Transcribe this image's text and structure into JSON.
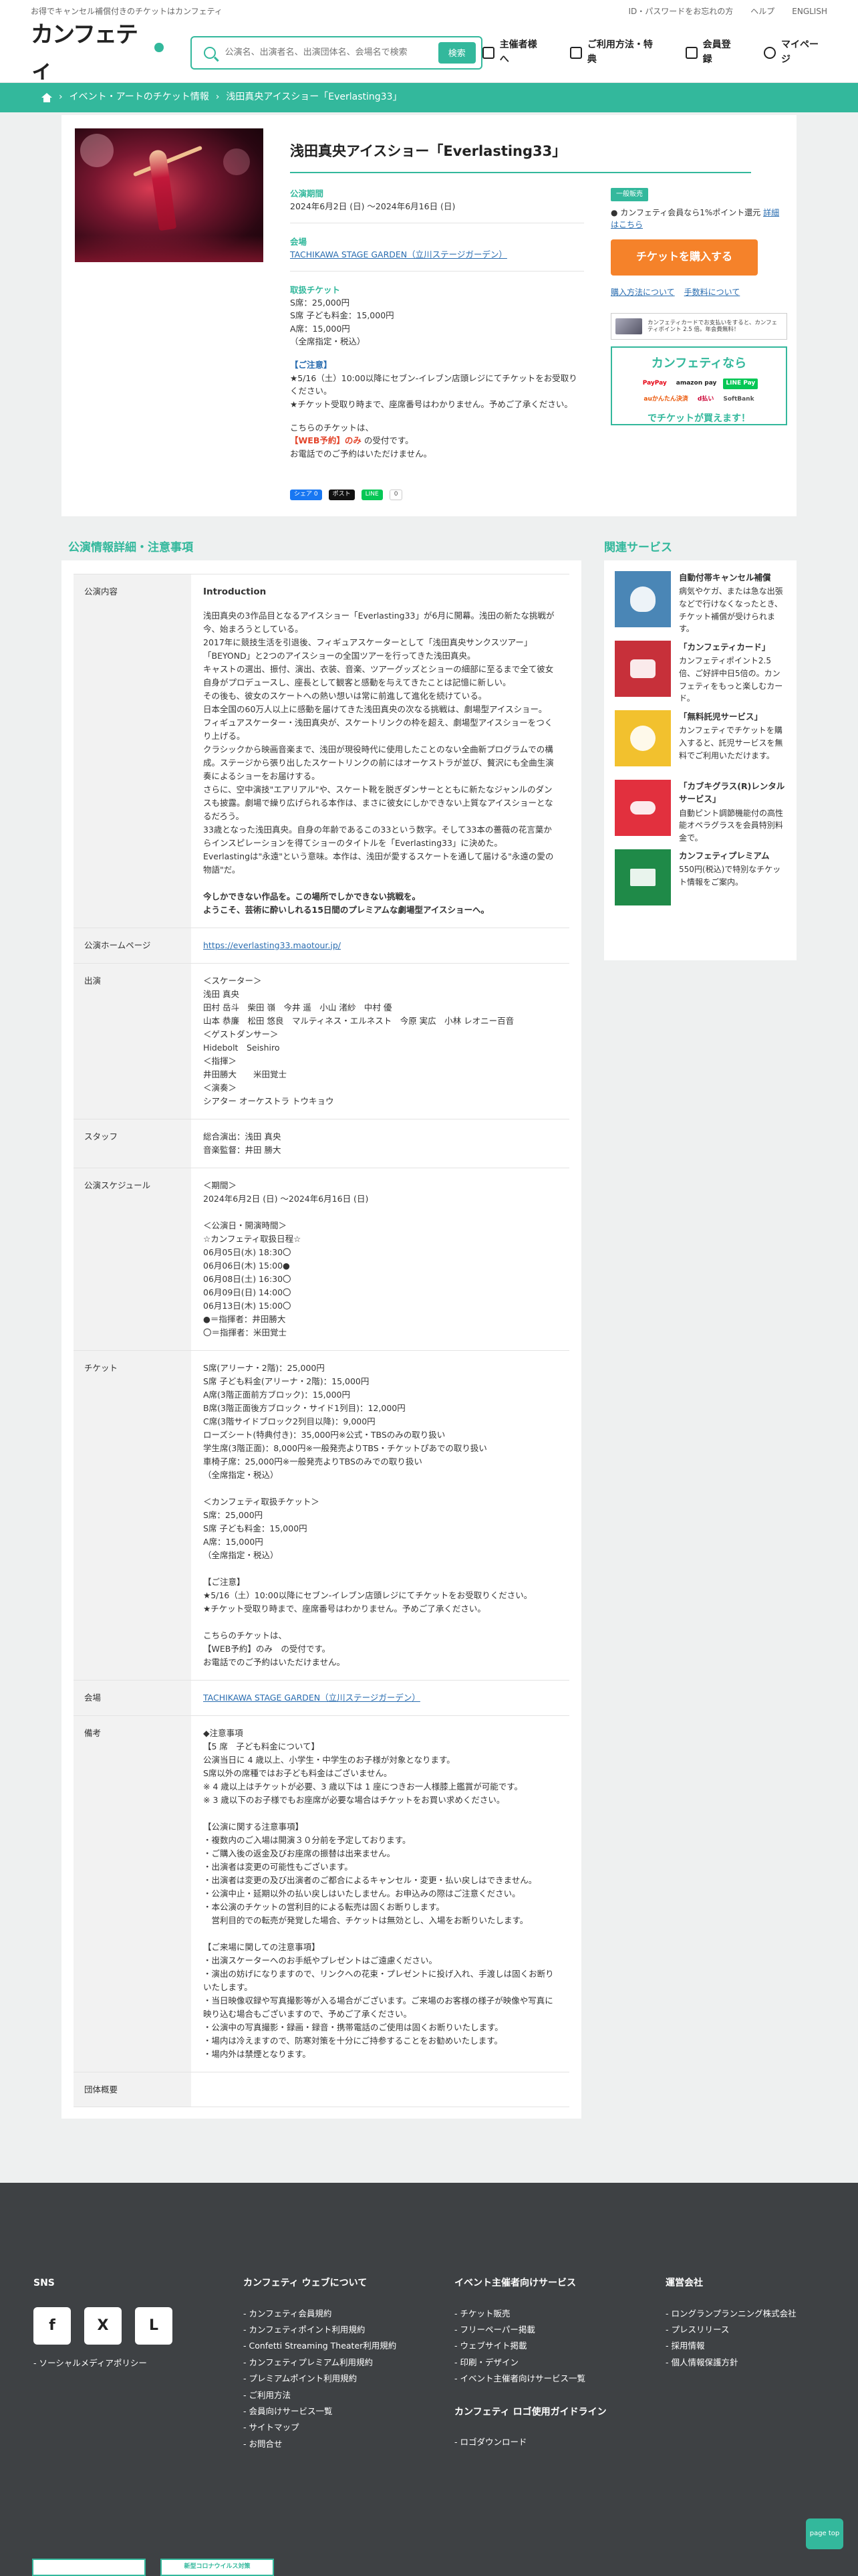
{
  "topbar": {
    "tagline": "お得でキャンセル補償付きのチケットはカンフェティ",
    "links": [
      "ID・パスワードをお忘れの方",
      "ヘルプ",
      "ENGLISH"
    ]
  },
  "header": {
    "logo": "カンフェティ",
    "search_placeholder": "公演名、出演者名、出演団体名、会場名で検索",
    "search_button": "検索",
    "nav": [
      "主催者様へ",
      "ご利用方法・特典",
      "会員登録",
      "マイページ"
    ]
  },
  "breadcrumb": [
    "イベント・アートのチケット情報",
    "浅田真央アイスショー「Everlasting33」"
  ],
  "event": {
    "title": "浅田真央アイスショー「Everlasting33」",
    "period_label": "公演期間",
    "period": "2024年6月2日 (日) ～2024年6月16日 (日)",
    "venue_label": "会場",
    "venue": "TACHIKAWA STAGE GARDEN（立川ステージガーデン）",
    "tickets_label": "取扱チケット",
    "tickets": [
      "S席：25,000円",
      "S席 子ども料金：15,000円",
      "A席：15,000円",
      "（全席指定・税込）"
    ],
    "notice_h": "【ご注意】",
    "notice_lines": [
      "★5/16（土）10:00以降にセブン-イレブン店頭レジにてチケットをお受取りください。",
      "★チケット受取り時まで、座席番号はわかりません。予めご了承ください。"
    ],
    "sale_line1": "こちらのチケットは、",
    "sale_web": "【WEB予約】のみ",
    "sale_line2": "の受付です。",
    "sale_line3": "お電話でのご予約はいただけません。",
    "share": [
      "シェア 0",
      "ポスト",
      "LINE",
      "0"
    ]
  },
  "buy": {
    "badge": "一般販売",
    "point_text": "カンフェティ会員なら1%ポイント還元",
    "point_link": "詳細はこちら",
    "button": "チケットを購入する",
    "link1": "購入方法について",
    "link2": "手数料について",
    "ad1_text": "カンフェティカードでお支払いをすると、カンフェティポイント 2.5 倍。年会費無料！",
    "ad2_title": "カンフェティなら",
    "ad2_pays": [
      "PayPay",
      "amazon pay",
      "LINE Pay",
      "auかんたん決済",
      "d払い",
      "SoftBank"
    ],
    "ad2_bottom": "でチケットが買えます！"
  },
  "details": {
    "heading": "公演情報詳細・注意事項",
    "rows": [
      {
        "label": "公演内容",
        "title": "Introduction",
        "body": "浅田真央の3作品目となるアイスショー「Everlasting33」が6月に開幕。浅田の新たな挑戦が今、始まろうとしている。\n2017年に競技生活を引退後、フィギュアスケーターとして「浅田真央サンクスツアー」「BEYOND」と2つのアイスショーの全国ツアーを行ってきた浅田真央。\nキャストの選出、振付、演出、衣装、音楽、ツアーグッズとショーの細部に至るまで全て彼女自身がプロデュースし、座長として観客と感動を与えてきたことは記憶に新しい。\nその後も、彼女のスケートへの熱い想いは常に前進して進化を続けている。\n日本全国の60万人以上に感動を届けてきた浅田真央の次なる挑戦は、劇場型アイスショー。\nフィギュアスケーター・浅田真央が、スケートリンクの枠を超え、劇場型アイスショーをつくり上げる。\nクラシックから映画音楽まで、浅田が現役時代に使用したことのない全曲新プログラムでの構成。ステージから張り出したスケートリンクの前にはオーケストラが並び、贅沢にも全曲生演奏によるショーをお届けする。\nさらに、空中演技\"エアリアル\"や、スケート靴を脱ぎダンサーとともに新たなジャンルのダンスも披露。劇場で繰り広げられる本作は、まさに彼女にしかできない上質なアイスショーとなるだろう。\n33歳となった浅田真央。自身の年齢であるこの33という数字。そして33本の薔薇の花言葉からインスピレーションを得てショーのタイトルを「Everlasting33」に決めた。\nEverlastingは\"永遠\"という意味。本作は、浅田が愛するスケートを通して届ける\"永遠の愛の物語\"だ。",
        "foot": "今しかできない作品を。この場所でしかできない挑戦を。\nようこそ、芸術に酔いしれる15日間のプレミアムな劇場型アイスショーへ。"
      },
      {
        "label": "公演ホームページ",
        "body": "https://everlasting33.maotour.jp/"
      },
      {
        "label": "出演",
        "body": "＜スケーター＞\n浅田 真央\n田村 岳斗　柴田 嶺　今井 遥　小山 渚紗　中村 優\n山本 恭廉　松田 悠良　マルティネス・エルネスト　今原 実広　小林 レオニー百音\n＜ゲストダンサー＞\nHidebolt　Seishiro\n＜指揮＞\n井田勝大　　米田覚士\n＜演奏＞\nシアター オーケストラ トウキョウ"
      },
      {
        "label": "スタッフ",
        "body": "総合演出：浅田 真央\n音楽監督：井田 勝大"
      },
      {
        "label": "公演スケジュール",
        "body": "＜期間＞\n2024年6月2日 (日) ～2024年6月16日 (日)\n\n＜公演日・開演時間＞\n☆カンフェティ取扱日程☆\n06月05日(水) 18:30〇\n06月06日(木) 15:00●\n06月08日(土) 16:30〇\n06月09日(日) 14:00〇\n06月13日(木) 15:00〇\n●＝指揮者：井田勝大\n〇＝指揮者：米田覚士"
      },
      {
        "label": "チケット",
        "body": "S席(アリーナ・2階)：25,000円\nS席 子ども料金(アリーナ・2階)：15,000円\nA席(3階正面前方ブロック)：15,000円\nB席(3階正面後方ブロック・サイド1列目)：12,000円\nC席(3階サイドブロック2列目以降)：9,000円\nローズシート(特典付き)：35,000円※公式・TBSのみの取り扱い\n学生席(3階正面)：8,000円※一般発売よりTBS・チケットぴあでの取り扱い\n車椅子席：25,000円※一般発売よりTBSのみでの取り扱い\n（全席指定・税込）\n\n＜カンフェティ取扱チケット＞\nS席：25,000円\nS席 子ども料金：15,000円\nA席：15,000円\n（全席指定・税込）\n\n【ご注意】\n★5/16（土）10:00以降にセブン-イレブン店頭レジにてチケットをお受取りください。\n★チケット受取り時まで、座席番号はわかりません。予めご了承ください。\n\nこちらのチケットは、\n【WEB予約】のみ　の受付です。\nお電話でのご予約はいただけません。"
      },
      {
        "label": "会場",
        "body": "TACHIKAWA STAGE GARDEN（立川ステージガーデン）"
      },
      {
        "label": "備考",
        "body": "◆注意事項\n【5 席　子ども料金について】\n公演当日に 4 歳以上、小学生・中学生のお子様が対象となります。\nS席以外の席種ではお子ども料金はございません。\n※ 4 歳以上はチケットが必要、3 歳以下は 1 座につきお一人様膝上鑑賞が可能です。\n※ 3 歳以下のお子様でもお座席が必要な場合はチケットをお買い求めください。\n\n【公演に関する注意事項】\n・複数内のご入場は開演３０分前を予定しております。\n・ご購入後の返金及びお座席の振替は出来ません。\n・出演者は変更の可能性もございます。\n・出演者は変更の及び出演者のご都合によるキャンセル・変更・払い戻しはできません。\n・公演中止・延期以外の払い戻しはいたしません。お申込みの際はご注意ください。\n・本公演のチケットの営利目的による転売は固くお断りします。\n　営利目的での転売が発覚した場合、チケットは無効とし、入場をお断りいたします。\n\n【ご来場に関しての注意事項】\n・出演スケーターへのお手紙やプレゼントはご遠慮ください。\n・演出の妨げになりますので、リンクへの花束・プレゼントに投げ入れ、手渡しは固くお断りいたします。\n・当日映像収録や写真撮影等が入る場合がございます。ご来場のお客様の様子が映像や写真に映り込む場合もございますので、予めご了承ください。\n・公演中の写真撮影・録画・録音・携帯電話のご使用は固くお断りいたします。\n・場内は冷えますので、防寒対策を十分にご持参することをお勧めいたします。\n・場内外は禁煙となります。"
      },
      {
        "label": "団体概要",
        "body": ""
      }
    ]
  },
  "services": {
    "heading": "関連サービス",
    "items": [
      {
        "title": "自動付帯キャンセル補償",
        "desc": "病気やケガ、または急な出張などで行けなくなったとき、チケット補償が受けられます。",
        "color": "#4a86b6"
      },
      {
        "title": "「カンフェティカード」",
        "desc": "カンフェティポイント2.5倍、ご好評中日5倍の。カンフェティをもっと楽しむカード。",
        "color": "#c7303a"
      },
      {
        "title": "「無料託児サービス」",
        "desc": "カンフェティでチケットを購入すると、託児サービスを無料でご利用いただけます。",
        "color": "#f2c12e"
      },
      {
        "title": "「カブキグラス(R)レンタルサービス」",
        "desc": "自動ピント調節機能付の高性能オペラグラスを会員特別料金で。",
        "color": "#e2303e"
      },
      {
        "title": "カンフェティプレミアム",
        "desc": "550円(税込)で特別なチケット情報をご案内。",
        "color": "#1f8a48"
      }
    ]
  },
  "footer": {
    "sns_title": "SNS",
    "sns_icons": [
      "f",
      "X",
      "L"
    ],
    "sns_policy": "ソーシャルメディアポリシー",
    "web_title": "カンフェティ ウェブについて",
    "web_links": [
      "カンフェティ会員規約",
      "カンフェティポイント利用規約",
      "Confetti Streaming Theater利用規約",
      "カンフェティプレミアム利用規約",
      "プレミアムポイント利用規約",
      "ご利用方法",
      "会員向けサービス一覧",
      "サイトマップ",
      "お問合せ"
    ],
    "org_title": "イベント主催者向けサービス",
    "org_links": [
      "チケット販売",
      "フリーペーパー掲載",
      "ウェブサイト掲載",
      "印刷・デザイン",
      "イベント主催者向けサービス一覧"
    ],
    "logo_title": "カンフェティ ロゴ使用ガイドライン",
    "logo_links": [
      "ロゴダウンロード"
    ],
    "company_title": "運営会社",
    "company_links": [
      "ロングランプランニング株式会社",
      "プレスリリース",
      "採用情報",
      "個人情報保護方針"
    ],
    "pagetop": "page top",
    "badges": [
      "",
      "新型コロナウイルス対策"
    ]
  }
}
